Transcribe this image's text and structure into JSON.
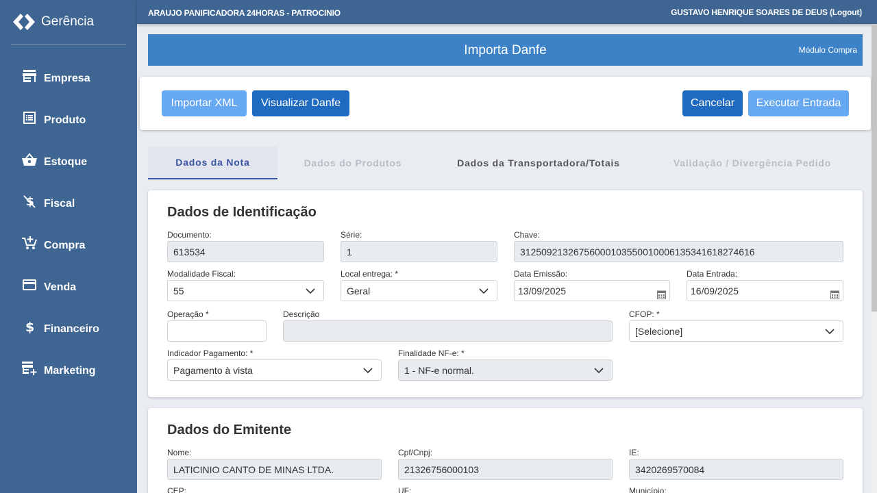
{
  "sidebar": {
    "brand": "Gerência",
    "items": [
      {
        "label": "Empresa",
        "icon": "store-icon"
      },
      {
        "label": "Produto",
        "icon": "list-icon"
      },
      {
        "label": "Estoque",
        "icon": "basket-icon"
      },
      {
        "label": "Fiscal",
        "icon": "money-off-icon"
      },
      {
        "label": "Compra",
        "icon": "cart-add-icon"
      },
      {
        "label": "Venda",
        "icon": "credit-card-icon"
      },
      {
        "label": "Financeiro",
        "icon": "dollar-icon"
      },
      {
        "label": "Marketing",
        "icon": "store-add-icon"
      }
    ]
  },
  "topbar": {
    "company": "ARAUJO PANIFICADORA 24HORAS - PATROCINIO",
    "user": "GUSTAVO HENRIQUE SOARES DE DEUS (Logout)"
  },
  "page": {
    "title": "Importa Danfe",
    "module": "Módulo Compra"
  },
  "toolbar": {
    "import_xml": "Importar XML",
    "view_danfe": "Visualizar Danfe",
    "cancel": "Cancelar",
    "execute": "Executar Entrada"
  },
  "tabs": [
    {
      "label": "Dados da Nota",
      "state": "active"
    },
    {
      "label": "Dados do Produtos",
      "state": "disabled"
    },
    {
      "label": "Dados da Transportadora/Totais",
      "state": "normal"
    },
    {
      "label": "Validação / Divergência Pedido",
      "state": "disabled"
    }
  ],
  "identificacao": {
    "title": "Dados de Identificação",
    "documento": {
      "label": "Documento:",
      "value": "613534"
    },
    "serie": {
      "label": "Série:",
      "value": "1"
    },
    "chave": {
      "label": "Chave:",
      "value": "31250921326756000103550010006135341618274616"
    },
    "modalidade": {
      "label": "Modalidade Fiscal:",
      "value": "55"
    },
    "local_entrega": {
      "label": "Local entrega: *",
      "value": "Geral"
    },
    "data_emissao": {
      "label": "Data Emissão:",
      "value": "13/09/2025"
    },
    "data_entrada": {
      "label": "Data Entrada:",
      "value": "16/09/2025"
    },
    "operacao": {
      "label": "Operação *",
      "value": ""
    },
    "descricao": {
      "label": "Descrição",
      "value": ""
    },
    "cfop": {
      "label": "CFOP: *",
      "value": "[Selecione]"
    },
    "indicador_pagamento": {
      "label": "Indicador Pagamento: *",
      "value": "Pagamento à vista"
    },
    "finalidade": {
      "label": "Finalidade NF-e: *",
      "value": "1 - NF-e normal."
    }
  },
  "emitente": {
    "title": "Dados do Emitente",
    "nome": {
      "label": "Nome:",
      "value": "LATICINIO CANTO DE MINAS LTDA."
    },
    "cpf_cnpj": {
      "label": "Cpf/Cnpj:",
      "value": "21326756000103"
    },
    "ie": {
      "label": "IE:",
      "value": "3420269570084"
    },
    "cep": {
      "label": "CEP:"
    },
    "uf": {
      "label": "UF:"
    },
    "municipio": {
      "label": "Município:"
    }
  },
  "colors": {
    "sidebar": "#3f6592",
    "title_bar": "#3d82c6",
    "button_light": "#67a8f2",
    "button_dark": "#1f6bc2",
    "tab_active": "#3b55a3"
  }
}
